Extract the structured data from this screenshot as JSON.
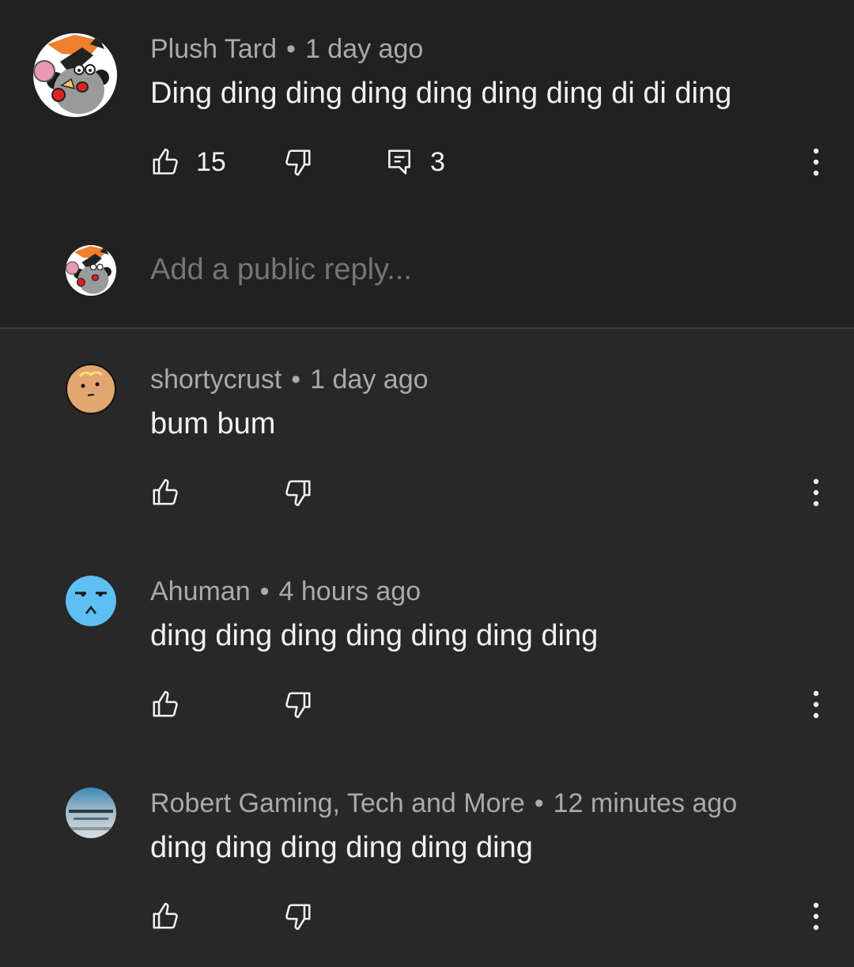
{
  "comments": [
    {
      "author": "Plush Tard",
      "separator": "•",
      "time": "1 day ago",
      "text": "Ding ding ding ding ding ding ding di di ding",
      "likes": "15",
      "replies": "3",
      "avatar": "plush-mouse-avatar"
    },
    {
      "author": "shortycrust",
      "separator": "•",
      "time": "1 day ago",
      "text": "bum bum",
      "avatar": "face-avatar"
    },
    {
      "author": "Ahuman",
      "separator": "•",
      "time": "4 hours ago",
      "text": "ding ding ding ding ding ding ding",
      "avatar": "blue-face-avatar"
    },
    {
      "author": "Robert Gaming, Tech and More",
      "separator": "•",
      "time": "12 minutes ago",
      "text": "ding ding ding ding ding ding",
      "avatar": "blurred-photo-avatar"
    }
  ],
  "reply_box": {
    "placeholder": "Add a public reply..."
  },
  "icons": {
    "like": "thumbs-up-icon",
    "dislike": "thumbs-down-icon",
    "reply": "comment-icon",
    "more": "vertical-dots-icon"
  },
  "colors": {
    "background": "#282828",
    "top_background": "#212121",
    "text": "#f1f1f1",
    "meta": "#aaaaaa",
    "ahuman_avatar": "#5ec0f2"
  }
}
